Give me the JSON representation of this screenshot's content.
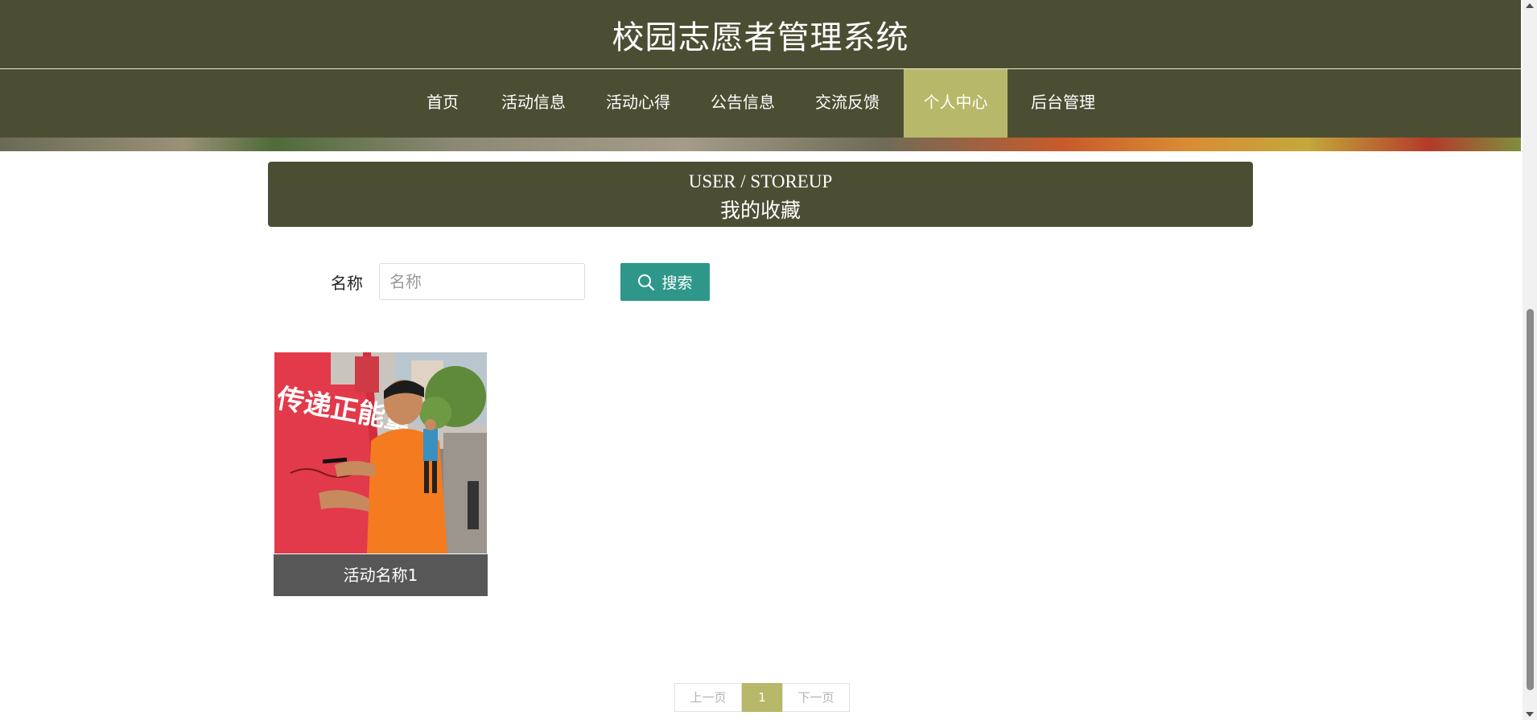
{
  "header": {
    "title": "校园志愿者管理系统"
  },
  "nav": {
    "items": [
      {
        "label": "首页"
      },
      {
        "label": "活动信息"
      },
      {
        "label": "活动心得"
      },
      {
        "label": "公告信息"
      },
      {
        "label": "交流反馈"
      },
      {
        "label": "个人中心",
        "active": true
      },
      {
        "label": "后台管理"
      }
    ]
  },
  "section": {
    "title_en": "USER / STOREUP",
    "title_zh": "我的收藏"
  },
  "search": {
    "label": "名称",
    "placeholder": "名称",
    "value": "",
    "button_label": "搜索",
    "button_icon": "search-icon"
  },
  "items": [
    {
      "name": "活动名称1"
    }
  ],
  "pagination": {
    "prev": "上一页",
    "current": "1",
    "next": "下一页"
  },
  "colors": {
    "primary": "#4c4e33",
    "accent": "#b8b86a",
    "button": "#2f978a",
    "caption_bg": "#575757"
  }
}
